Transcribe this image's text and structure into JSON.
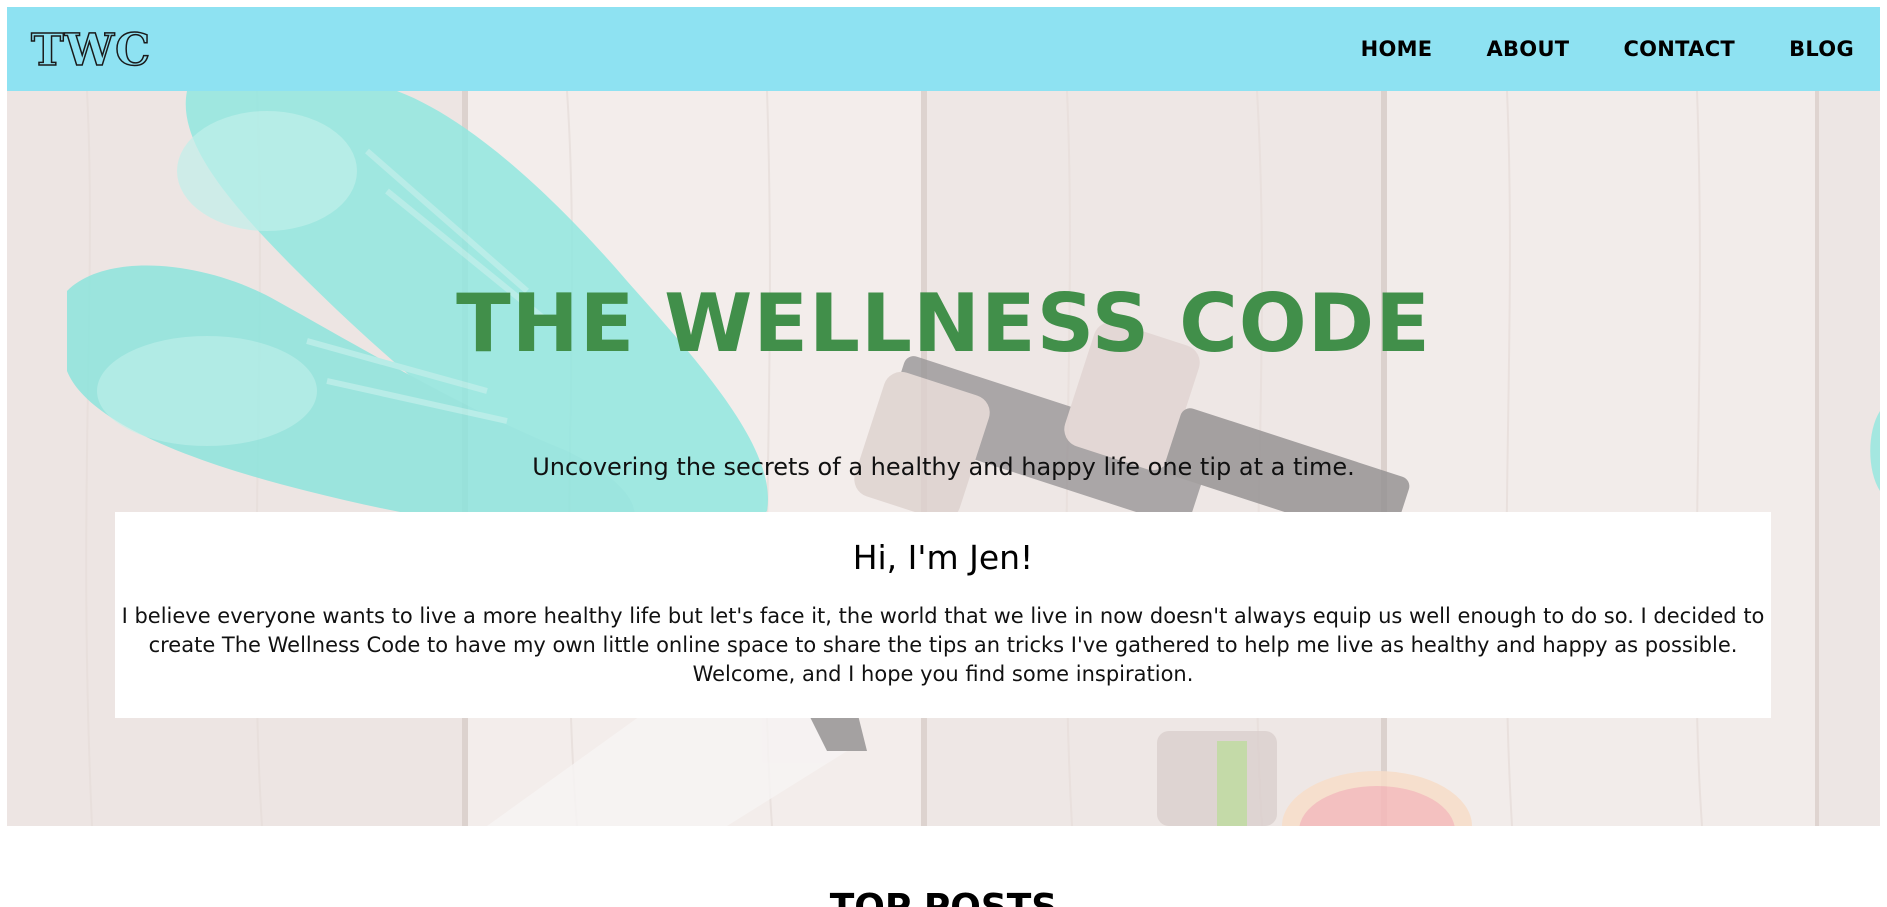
{
  "navbar": {
    "logo": "TWC",
    "background": "#8ee2f2",
    "links": [
      {
        "label": "HOME"
      },
      {
        "label": "ABOUT"
      },
      {
        "label": "CONTACT"
      },
      {
        "label": "BLOG"
      }
    ]
  },
  "hero": {
    "title": "THE WELLNESS CODE",
    "title_color": "#418f4a",
    "tagline": "Uncovering the secrets of a healthy and happy life one tip at a time.",
    "background_image": "sneakers-dumbbells-water-bottle-grapefruit-on-wood-floor"
  },
  "intro": {
    "heading": "Hi, I'm Jen!",
    "body": "I believe everyone wants to live a more healthy life but let's face it, the world that we live in now doesn't always equip us well enough to do so. I decided to create The Wellness Code to have my own little online space to share the tips an tricks I've gathered to help me live as healthy and happy as possible. Welcome, and I hope you find some inspiration."
  },
  "top_posts": {
    "heading": "TOP POSTS"
  }
}
